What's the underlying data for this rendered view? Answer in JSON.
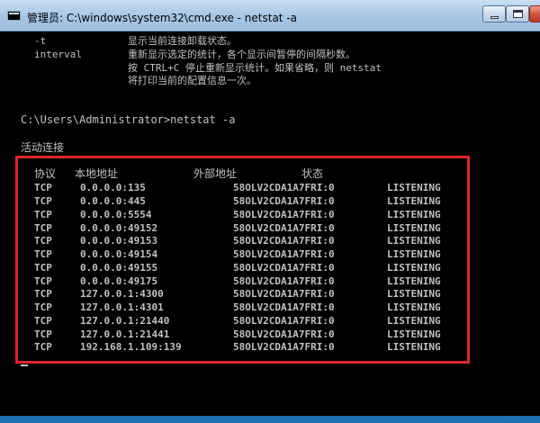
{
  "window": {
    "title": "管理员: C:\\windows\\system32\\cmd.exe - netstat  -a"
  },
  "help": {
    "t_param": "-t",
    "t_desc": "显示当前连接卸载状态。",
    "interval_param": "interval",
    "interval_desc_1": "重新显示选定的统计，各个显示间暂停的间隔秒数。",
    "interval_desc_2": "按 CTRL+C 停止重新显示统计。如果省略，则 netstat",
    "interval_desc_3": "将打印当前的配置信息一次。"
  },
  "prompt": "C:\\Users\\Administrator>netstat -a",
  "section_title": "活动连接",
  "table": {
    "headers": {
      "protocol": "协议",
      "local": "本地地址",
      "foreign": "外部地址",
      "state": "状态"
    },
    "rows": [
      {
        "proto": "TCP",
        "local": "0.0.0.0:135",
        "foreign": "58OLV2CDA1A7FRI:0",
        "state": "LISTENING"
      },
      {
        "proto": "TCP",
        "local": "0.0.0.0:445",
        "foreign": "58OLV2CDA1A7FRI:0",
        "state": "LISTENING"
      },
      {
        "proto": "TCP",
        "local": "0.0.0.0:5554",
        "foreign": "58OLV2CDA1A7FRI:0",
        "state": "LISTENING"
      },
      {
        "proto": "TCP",
        "local": "0.0.0.0:49152",
        "foreign": "58OLV2CDA1A7FRI:0",
        "state": "LISTENING"
      },
      {
        "proto": "TCP",
        "local": "0.0.0.0:49153",
        "foreign": "58OLV2CDA1A7FRI:0",
        "state": "LISTENING"
      },
      {
        "proto": "TCP",
        "local": "0.0.0.0:49154",
        "foreign": "58OLV2CDA1A7FRI:0",
        "state": "LISTENING"
      },
      {
        "proto": "TCP",
        "local": "0.0.0.0:49155",
        "foreign": "58OLV2CDA1A7FRI:0",
        "state": "LISTENING"
      },
      {
        "proto": "TCP",
        "local": "0.0.0.0:49175",
        "foreign": "58OLV2CDA1A7FRI:0",
        "state": "LISTENING"
      },
      {
        "proto": "TCP",
        "local": "127.0.0.1:4300",
        "foreign": "58OLV2CDA1A7FRI:0",
        "state": "LISTENING"
      },
      {
        "proto": "TCP",
        "local": "127.0.0.1:4301",
        "foreign": "58OLV2CDA1A7FRI:0",
        "state": "LISTENING"
      },
      {
        "proto": "TCP",
        "local": "127.0.0.1:21440",
        "foreign": "58OLV2CDA1A7FRI:0",
        "state": "LISTENING"
      },
      {
        "proto": "TCP",
        "local": "127.0.0.1:21441",
        "foreign": "58OLV2CDA1A7FRI:0",
        "state": "LISTENING"
      },
      {
        "proto": "TCP",
        "local": "192.168.1.109:139",
        "foreign": "58OLV2CDA1A7FRI:0",
        "state": "LISTENING"
      }
    ]
  },
  "colors": {
    "console_bg": "#000000",
    "console_text": "#c0c0c0",
    "highlight_border": "#e0242b",
    "desktop": "#2a89cf"
  }
}
